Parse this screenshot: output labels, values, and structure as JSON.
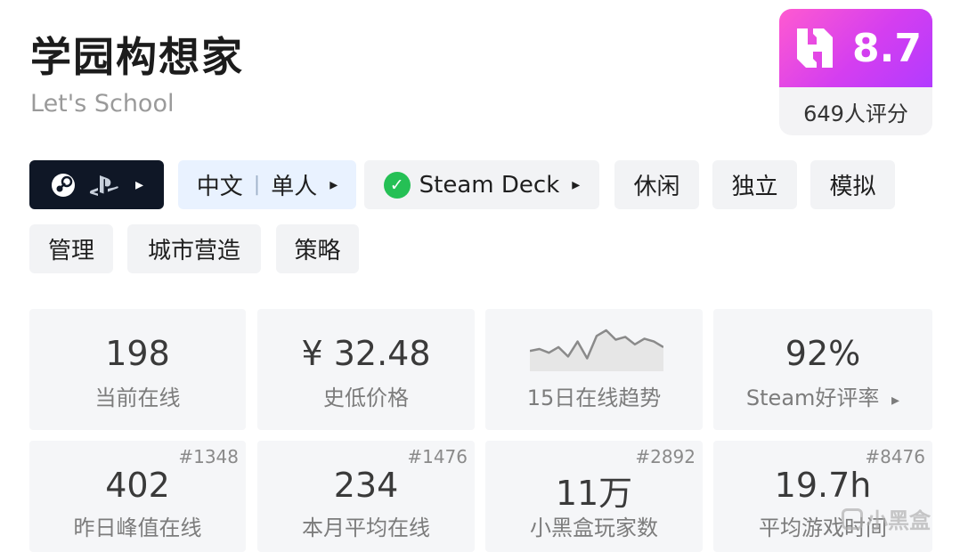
{
  "header": {
    "title": "学园构想家",
    "subtitle": "Let's School"
  },
  "score": {
    "value": "8.7",
    "raters": "649人评分",
    "logo_icon": "heybox-logo-icon",
    "gradient": [
      "#ff5ad0",
      "#b23bff"
    ]
  },
  "platform_chip": {
    "icons": [
      "steam-icon",
      "playstation-icon"
    ],
    "arrow": "▸"
  },
  "language_chip": {
    "language": "中文",
    "mode": "单人",
    "arrow": "▸"
  },
  "deck_chip": {
    "check": "✓",
    "label": "Steam Deck",
    "arrow": "▸"
  },
  "tags": [
    "休闲",
    "独立",
    "模拟",
    "管理",
    "城市营造",
    "策略"
  ],
  "stats": {
    "online": {
      "value": "198",
      "label": "当前在线"
    },
    "lowest_price": {
      "value": "¥ 32.48",
      "label": "史低价格"
    },
    "trend": {
      "label": "15日在线趋势",
      "series": [
        18,
        20,
        16,
        22,
        12,
        28,
        10,
        34,
        40,
        30,
        33,
        25,
        31,
        28,
        22
      ]
    },
    "rating": {
      "value": "92%",
      "label": "Steam好评率",
      "arrow": "▸"
    },
    "peak_yesterday": {
      "value": "402",
      "label": "昨日峰值在线",
      "rank": "#1348"
    },
    "monthly_avg": {
      "value": "234",
      "label": "本月平均在线",
      "rank": "#1476"
    },
    "players": {
      "value": "11万",
      "label": "小黑盒玩家数",
      "rank": "#2892"
    },
    "avg_playtime": {
      "value": "19.7h",
      "label": "平均游戏时间",
      "rank": "#8476"
    }
  },
  "watermark": "小黑盒"
}
